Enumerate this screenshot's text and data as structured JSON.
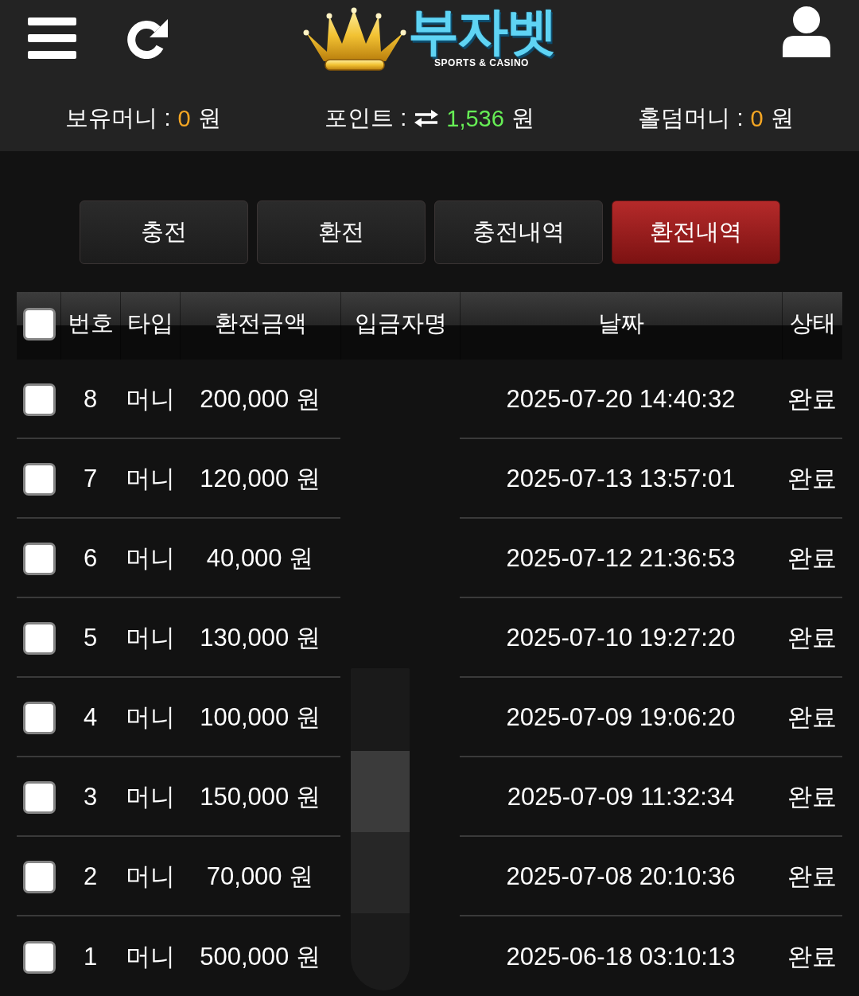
{
  "header": {
    "logo": {
      "title": "부자벳",
      "subtitle": "SPORTS & CASINO"
    }
  },
  "balances": [
    {
      "kind": "money",
      "label": "보유머니 :",
      "value": "0",
      "unit": "원"
    },
    {
      "kind": "point",
      "label": "포인트 :",
      "value": "1,536",
      "unit": "원"
    },
    {
      "kind": "money",
      "label": "홀덤머니 :",
      "value": "0",
      "unit": "원"
    }
  ],
  "tabs": [
    {
      "label": "충전",
      "selected": false
    },
    {
      "label": "환전",
      "selected": false
    },
    {
      "label": "충전내역",
      "selected": false
    },
    {
      "label": "환전내역",
      "selected": true
    }
  ],
  "table": {
    "select_all": {
      "checked": false
    },
    "columns": [
      "번호",
      "타입",
      "환전금액",
      "입금자명",
      "날짜",
      "상태"
    ],
    "rows": [
      {
        "checked": false,
        "number": "8",
        "type": "머니",
        "amount": "200,000 원",
        "date": "2025-07-20 14:40:32",
        "status": "완료"
      },
      {
        "checked": false,
        "number": "7",
        "type": "머니",
        "amount": "120,000 원",
        "date": "2025-07-13 13:57:01",
        "status": "완료"
      },
      {
        "checked": false,
        "number": "6",
        "type": "머니",
        "amount": "40,000 원",
        "date": "2025-07-12 21:36:53",
        "status": "완료"
      },
      {
        "checked": false,
        "number": "5",
        "type": "머니",
        "amount": "130,000 원",
        "date": "2025-07-10 19:27:20",
        "status": "완료"
      },
      {
        "checked": false,
        "number": "4",
        "type": "머니",
        "amount": "100,000 원",
        "date": "2025-07-09 19:06:20",
        "status": "완료"
      },
      {
        "checked": false,
        "number": "3",
        "type": "머니",
        "amount": "150,000 원",
        "date": "2025-07-09 11:32:34",
        "status": "완료"
      },
      {
        "checked": false,
        "number": "2",
        "type": "머니",
        "amount": "70,000 원",
        "date": "2025-07-08 20:10:36",
        "status": "완료"
      },
      {
        "checked": false,
        "number": "1",
        "type": "머니",
        "amount": "500,000 원",
        "date": "2025-06-18 03:10:13",
        "status": "완료"
      }
    ]
  }
}
